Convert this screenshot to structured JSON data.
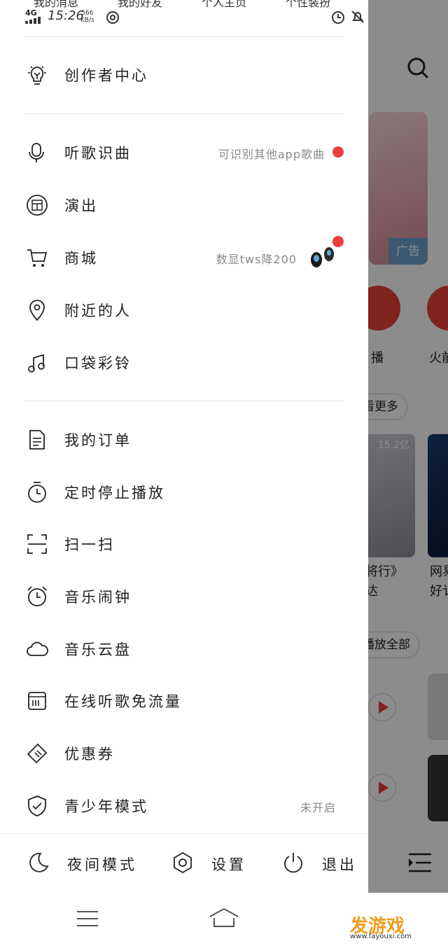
{
  "status_bar": {
    "network": "4G",
    "time": "15:26",
    "speed_value": "566",
    "speed_unit": "KB/s"
  },
  "top_tabs": [
    "我的消息",
    "我的好友",
    "个人主页",
    "个性装扮"
  ],
  "drawer": {
    "creator_center": "创作者中心",
    "section1": [
      {
        "label": "听歌识曲",
        "extra": "可识别其他app歌曲",
        "icon": "mic-music-icon"
      },
      {
        "label": "演出",
        "icon": "ticket-icon"
      },
      {
        "label": "商城",
        "extra": "数显tws降200",
        "icon": "cart-icon"
      },
      {
        "label": "附近的人",
        "icon": "location-pin-icon"
      },
      {
        "label": "口袋彩铃",
        "icon": "music-note-icon"
      }
    ],
    "section2": [
      {
        "label": "我的订单",
        "icon": "document-icon"
      },
      {
        "label": "定时停止播放",
        "icon": "timer-icon"
      },
      {
        "label": "扫一扫",
        "icon": "scan-icon"
      },
      {
        "label": "音乐闹钟",
        "icon": "alarm-clock-icon"
      },
      {
        "label": "音乐云盘",
        "icon": "cloud-icon"
      },
      {
        "label": "在线听歌免流量",
        "icon": "sim-card-icon"
      },
      {
        "label": "优惠券",
        "icon": "coupon-icon"
      },
      {
        "label": "青少年模式",
        "extra": "未开启",
        "icon": "shield-check-icon"
      }
    ],
    "footer": {
      "night_mode": "夜间模式",
      "settings": "设置",
      "logout": "退出"
    }
  },
  "background": {
    "ad_label": "广告",
    "icon_label_1": "播",
    "icon_label_2": "火前",
    "more_label": "看更多",
    "play_count": "15.2亿",
    "card_text_1": "将行》",
    "card_text_1b": "达",
    "card_text_2": "网易",
    "card_text_2b": "好讠",
    "play_all": "播放全部"
  },
  "watermark": {
    "text": "发游戏",
    "url": "www.fayouxi.com"
  },
  "colors": {
    "accent_red": "#ec3c3c",
    "watermark_orange": "#f29c1f"
  }
}
